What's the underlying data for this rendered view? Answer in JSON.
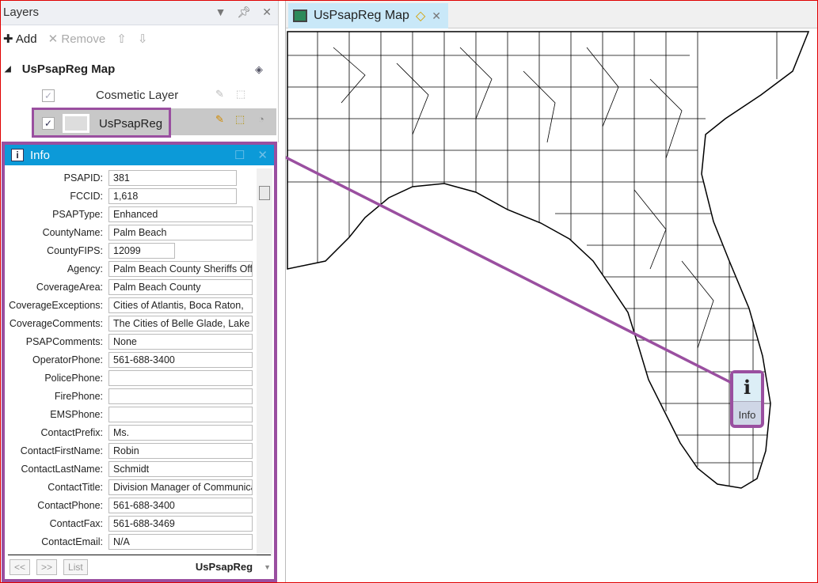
{
  "layers_panel": {
    "title": "Layers",
    "toolbar": {
      "add": "Add",
      "remove": "Remove"
    },
    "map_name": "UsPsapReg Map",
    "layers": [
      {
        "name": "Cosmetic Layer",
        "checked": true
      },
      {
        "name": "UsPsapReg",
        "checked": true,
        "selected": true
      }
    ]
  },
  "info_panel": {
    "title": "Info",
    "fields": [
      {
        "label": "PSAPID:",
        "value": "381",
        "w": "short"
      },
      {
        "label": "FCCID:",
        "value": "1,618",
        "w": "short"
      },
      {
        "label": "PSAPType:",
        "value": "Enhanced"
      },
      {
        "label": "CountyName:",
        "value": "Palm Beach"
      },
      {
        "label": "CountyFIPS:",
        "value": "12099",
        "w": "tiny"
      },
      {
        "label": "Agency:",
        "value": "Palm Beach County Sheriffs Office"
      },
      {
        "label": "CoverageArea:",
        "value": "Palm Beach County"
      },
      {
        "label": "CoverageExceptions:",
        "value": "Cities of Atlantis, Boca Raton,"
      },
      {
        "label": "CoverageComments:",
        "value": "The Cities of Belle Glade, Lake"
      },
      {
        "label": "PSAPComments:",
        "value": "None"
      },
      {
        "label": "OperatorPhone:",
        "value": "561-688-3400"
      },
      {
        "label": "PolicePhone:",
        "value": ""
      },
      {
        "label": "FirePhone:",
        "value": ""
      },
      {
        "label": "EMSPhone:",
        "value": ""
      },
      {
        "label": "ContactPrefix:",
        "value": "Ms."
      },
      {
        "label": "ContactFirstName:",
        "value": "Robin"
      },
      {
        "label": "ContactLastName:",
        "value": "Schmidt"
      },
      {
        "label": "ContactTitle:",
        "value": "Division Manager of Communications"
      },
      {
        "label": "ContactPhone:",
        "value": "561-688-3400"
      },
      {
        "label": "ContactFax:",
        "value": "561-688-3469"
      },
      {
        "label": "ContactEmail:",
        "value": "N/A"
      }
    ],
    "footer": {
      "prev": "<<",
      "next": ">>",
      "list": "List",
      "layer": "UsPsapReg"
    }
  },
  "map_view": {
    "tab_title": "UsPsapReg Map",
    "info_tool_label": "Info",
    "info_tool_glyph": "i"
  },
  "colors": {
    "highlight": "#9a4fa0",
    "info_header": "#0c9ad8"
  }
}
